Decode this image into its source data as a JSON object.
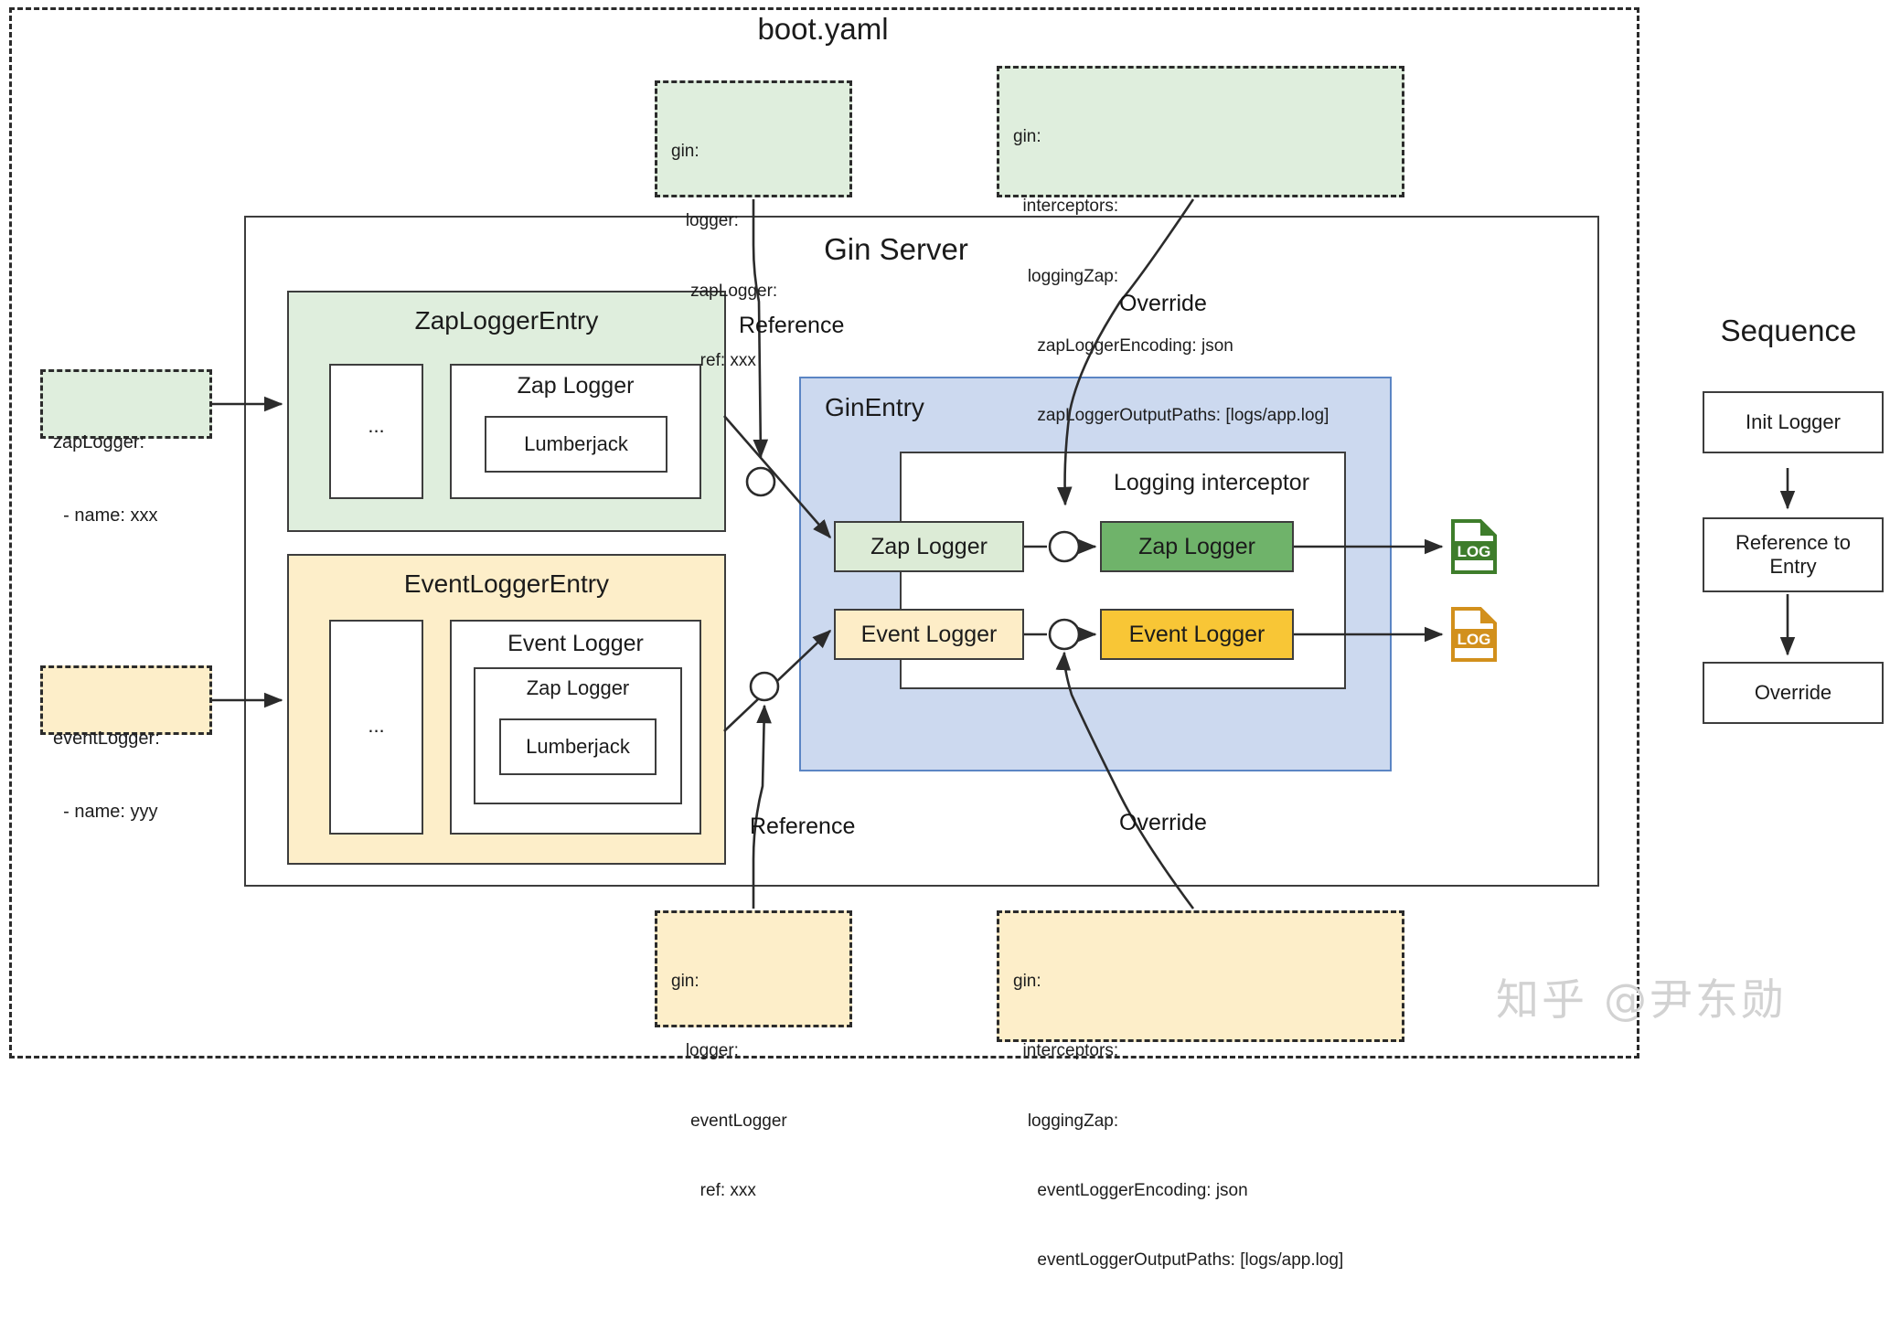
{
  "diagram": {
    "outer_label": "boot.yaml",
    "server_label": "Gin Server",
    "entry_label": "GinEntry",
    "interceptor_label": "Logging interceptor",
    "watermark": "知乎 @尹东勋"
  },
  "colors": {
    "green_fill": "#dfeedd",
    "green_strong": "#6fb36a",
    "yellow_fill": "#fdeec9",
    "yellow_strong": "#f8c636",
    "blue_fill": "#ccd9ef",
    "stroke": "#3d3d3d",
    "log_green": "#3e7d2b",
    "log_orange": "#d2901c"
  },
  "labels": {
    "reference_top": "Reference",
    "reference_bottom": "Reference",
    "override_top": "Override",
    "override_bottom": "Override"
  },
  "left_refs": [
    {
      "lines": [
        "zapLogger:",
        "  - name: xxx"
      ]
    },
    {
      "lines": [
        "eventLogger:",
        "  - name: yyy"
      ]
    }
  ],
  "config_boxes": {
    "top_reference": {
      "lines": [
        "gin:",
        "   logger:",
        "    zapLogger:",
        "      ref: xxx"
      ]
    },
    "top_override": {
      "lines": [
        "gin:",
        "  interceptors:",
        "   loggingZap:",
        "     zapLoggerEncoding: json",
        "     zapLoggerOutputPaths: [logs/app.log]"
      ]
    },
    "bottom_reference": {
      "lines": [
        "gin:",
        "   logger:",
        "    eventLogger",
        "      ref: xxx"
      ]
    },
    "bottom_override": {
      "lines": [
        "gin:",
        "  interceptors:",
        "   loggingZap:",
        "     eventLoggerEncoding: json",
        "     eventLoggerOutputPaths: [logs/app.log]"
      ]
    }
  },
  "zap_logger_entry": {
    "title": "ZapLoggerEntry",
    "ellipsis": "...",
    "inner_title": "Zap Logger",
    "leaf_title": "Lumberjack"
  },
  "event_logger_entry": {
    "title": "EventLoggerEntry",
    "ellipsis": "...",
    "inner_title": "Event Logger",
    "inner_title_2": "Zap Logger",
    "leaf_title": "Lumberjack"
  },
  "gin_entry": {
    "zap_logger_left": "Zap Logger",
    "event_logger_left": "Event Logger",
    "zap_logger_right": "Zap Logger",
    "event_logger_right": "Event Logger"
  },
  "log_files": {
    "zap_log_text": "LOG",
    "event_log_text": "LOG"
  },
  "sequence": {
    "title": "Sequence",
    "steps": [
      {
        "label": "Init Logger"
      },
      {
        "label": "Reference to\nEntry"
      },
      {
        "label": "Override"
      }
    ]
  }
}
